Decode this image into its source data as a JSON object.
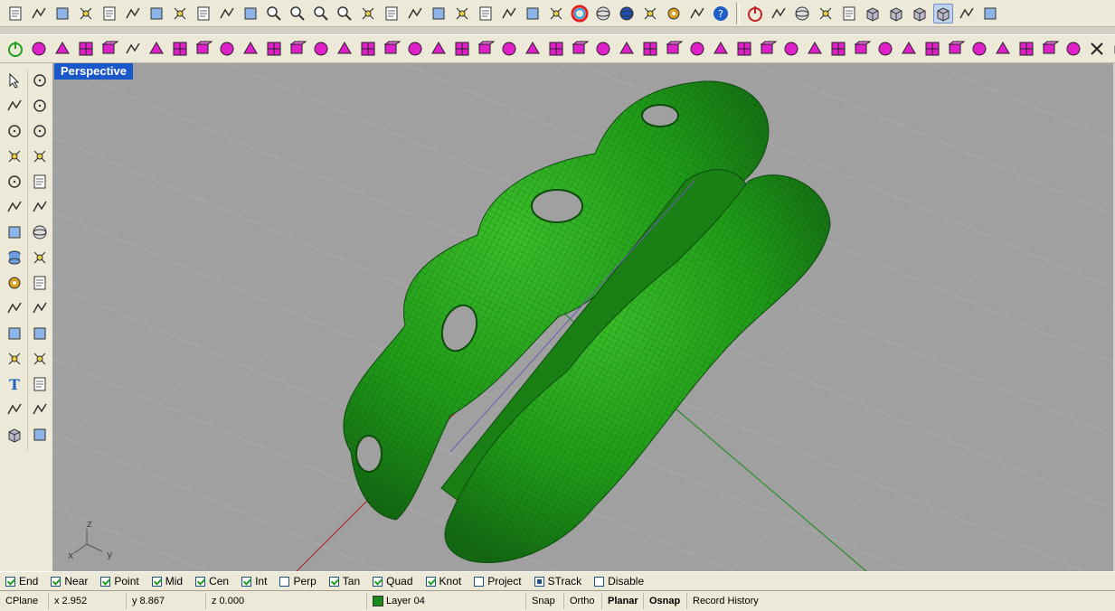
{
  "viewport": {
    "title": "Perspective"
  },
  "axis_labels": {
    "z": "z",
    "x": "x",
    "y": "y"
  },
  "toolbar_top": [
    "new-file-icon",
    "open-folder-icon",
    "save-icon",
    "print-icon",
    "import-icon",
    "cut-icon",
    "copy-icon",
    "paste-icon",
    "undo-icon",
    "pan-hand-icon",
    "rotate-view-icon",
    "zoom-icon",
    "zoom-window-icon",
    "zoom-extents-icon",
    "zoom-selected-icon",
    "undo-view-icon",
    "four-viewports-icon",
    "car-icon",
    "cplane-icon",
    "cplane-origin-icon",
    "object-snap-icon",
    "light-bulb-icon",
    "lock-icon",
    "layer-icon",
    "color-wheel-icon",
    "wireframe-sphere-icon",
    "render-sphere-icon",
    "bucket-icon",
    "options-gear-icon",
    "grid-tools-icon",
    "help-icon"
  ],
  "toolbar_top_right": [
    "power-icon",
    "vertex-icon",
    "sphere-grid-icon",
    "nodes-icon",
    "axes-icon",
    "cube-view-1-icon",
    "cube-view-2-icon",
    "cube-view-3-icon",
    "cube-view-4-icon",
    "wrench-icon",
    "extra-icon"
  ],
  "toolbar_second": [
    "power-green-icon",
    "box-magenta-icon",
    "sphere-magenta-icon",
    "rotate-magenta-icon",
    "bars-magenta-icon",
    "box-wire-icon",
    "arrow-magenta-icon",
    "transform-magenta-icon",
    "scale-magenta-icon",
    "bend-magenta-icon",
    "twist-magenta-icon",
    "taper-magenta-icon",
    "offset-magenta-icon",
    "arc-magenta-icon",
    "loft-magenta-icon",
    "rail-magenta-icon",
    "blend-magenta-icon",
    "extrude-magenta-icon",
    "cap-magenta-icon",
    "fillet-magenta-icon",
    "chamfer-magenta-icon",
    "split-magenta-icon",
    "join-magenta-icon",
    "explode-magenta-icon",
    "check-magenta-icon",
    "grid-magenta-icon",
    "array-magenta-icon",
    "mirror-magenta-icon",
    "scale2-magenta-icon",
    "move-magenta-icon",
    "flow-magenta-icon",
    "morph-magenta-icon",
    "pipe-magenta-icon",
    "cage-magenta-icon",
    "stretch-magenta-icon",
    "array2-magenta-icon",
    "curve-magenta-icon",
    "cross-magenta-icon",
    "branch-magenta-icon",
    "diamond-magenta-icon",
    "target-magenta-icon",
    "star-magenta-icon",
    "pentagon-magenta-icon",
    "flag-magenta-icon",
    "panel-magenta-icon",
    "panel2-magenta-icon",
    "x-close-icon",
    "cube-black-icon",
    "gear-magenta-icon"
  ],
  "left_tools_col1": [
    "select-arrow-icon",
    "polyline-icon",
    "circle-icon",
    "polygon-icon",
    "ellipse-icon",
    "surface-icon",
    "box-solid-icon",
    "cylinder-icon",
    "gear-solid-icon",
    "split-tool-icon",
    "boolean-icon",
    "curve-tool-icon",
    "text-tool-icon",
    "array-tool-icon",
    "solid-cube-icon"
  ],
  "left_tools_col2": [
    "point-icon",
    "control-points-icon",
    "ellipse2-icon",
    "rectangle-icon",
    "arc-icon",
    "revolve-icon",
    "sphere-tool-icon",
    "patch-icon",
    "explode-tool-icon",
    "trim-tool-icon",
    "boolean2-icon",
    "offset-tool-icon",
    "scale-tool-icon",
    "dimension-icon",
    "plane-tool-icon"
  ],
  "osnap": [
    {
      "label": "End",
      "checked": true
    },
    {
      "label": "Near",
      "checked": true
    },
    {
      "label": "Point",
      "checked": true
    },
    {
      "label": "Mid",
      "checked": true
    },
    {
      "label": "Cen",
      "checked": true
    },
    {
      "label": "Int",
      "checked": true
    },
    {
      "label": "Perp",
      "checked": false
    },
    {
      "label": "Tan",
      "checked": true
    },
    {
      "label": "Quad",
      "checked": true
    },
    {
      "label": "Knot",
      "checked": true
    },
    {
      "label": "Project",
      "checked": false
    },
    {
      "label": "STrack",
      "checked": "filled"
    },
    {
      "label": "Disable",
      "checked": false
    }
  ],
  "status": {
    "cplane": "CPlane",
    "x": "x 2.952",
    "y": "y 8.867",
    "z": "z 0.000",
    "layer": "Layer 04",
    "layer_color": "#1a8a1a",
    "snap": "Snap",
    "ortho": "Ortho",
    "planar": "Planar",
    "osnap": "Osnap",
    "record_history": "Record History"
  }
}
